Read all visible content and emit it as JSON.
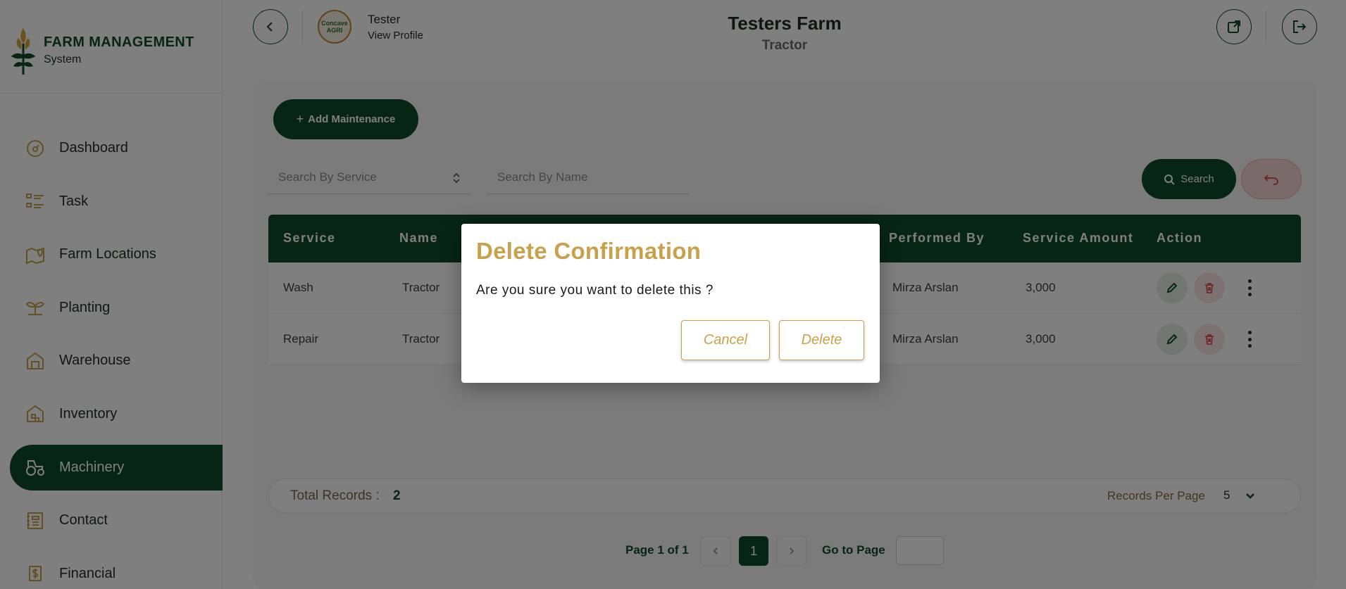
{
  "brand": {
    "title": "FARM MANAGEMENT",
    "subtitle": "System"
  },
  "sidebar": {
    "items": [
      {
        "label": "Dashboard",
        "icon": "dashboard-icon",
        "active": false
      },
      {
        "label": "Task",
        "icon": "task-list-icon",
        "active": false
      },
      {
        "label": "Farm Locations",
        "icon": "map-pin-icon",
        "active": false
      },
      {
        "label": "Planting",
        "icon": "plant-icon",
        "active": false
      },
      {
        "label": "Warehouse",
        "icon": "warehouse-icon",
        "active": false
      },
      {
        "label": "Inventory",
        "icon": "inventory-icon",
        "active": false
      },
      {
        "label": "Machinery",
        "icon": "tractor-icon",
        "active": true
      },
      {
        "label": "Contact",
        "icon": "contact-book-icon",
        "active": false
      },
      {
        "label": "Financial",
        "icon": "money-icon",
        "active": false
      }
    ]
  },
  "header": {
    "user_name": "Tester",
    "view_profile": "View Profile",
    "avatar_text": "Concave AGRI",
    "farm_title": "Testers Farm",
    "farm_subtitle": "Tractor"
  },
  "toolbar": {
    "add_label": "Add Maintenance",
    "search_service_placeholder": "Search By Service",
    "search_name_placeholder": "Search By Name",
    "search_label": "Search"
  },
  "table": {
    "columns": [
      "Service",
      "Name",
      "Performed By",
      "Service Amount",
      "Action"
    ],
    "rows": [
      {
        "service": "Wash",
        "name": "Tractor",
        "performed_by": "Mirza Arslan",
        "amount": "3,000"
      },
      {
        "service": "Repair",
        "name": "Tractor",
        "performed_by": "Mirza Arslan",
        "amount": "3,000"
      }
    ]
  },
  "footer": {
    "total_label": "Total Records :",
    "total_value": "2",
    "rpp_label": "Records Per Page",
    "rpp_value": "5",
    "page_info": "Page 1 of 1",
    "current_page": "1",
    "goto_label": "Go to Page"
  },
  "modal": {
    "title": "Delete Confirmation",
    "message": "Are you sure you want to delete this ?",
    "cancel_label": "Cancel",
    "delete_label": "Delete"
  },
  "colors": {
    "primary": "#0e4a2a",
    "accent_gold": "#c9a14a",
    "danger": "#d9534f"
  }
}
